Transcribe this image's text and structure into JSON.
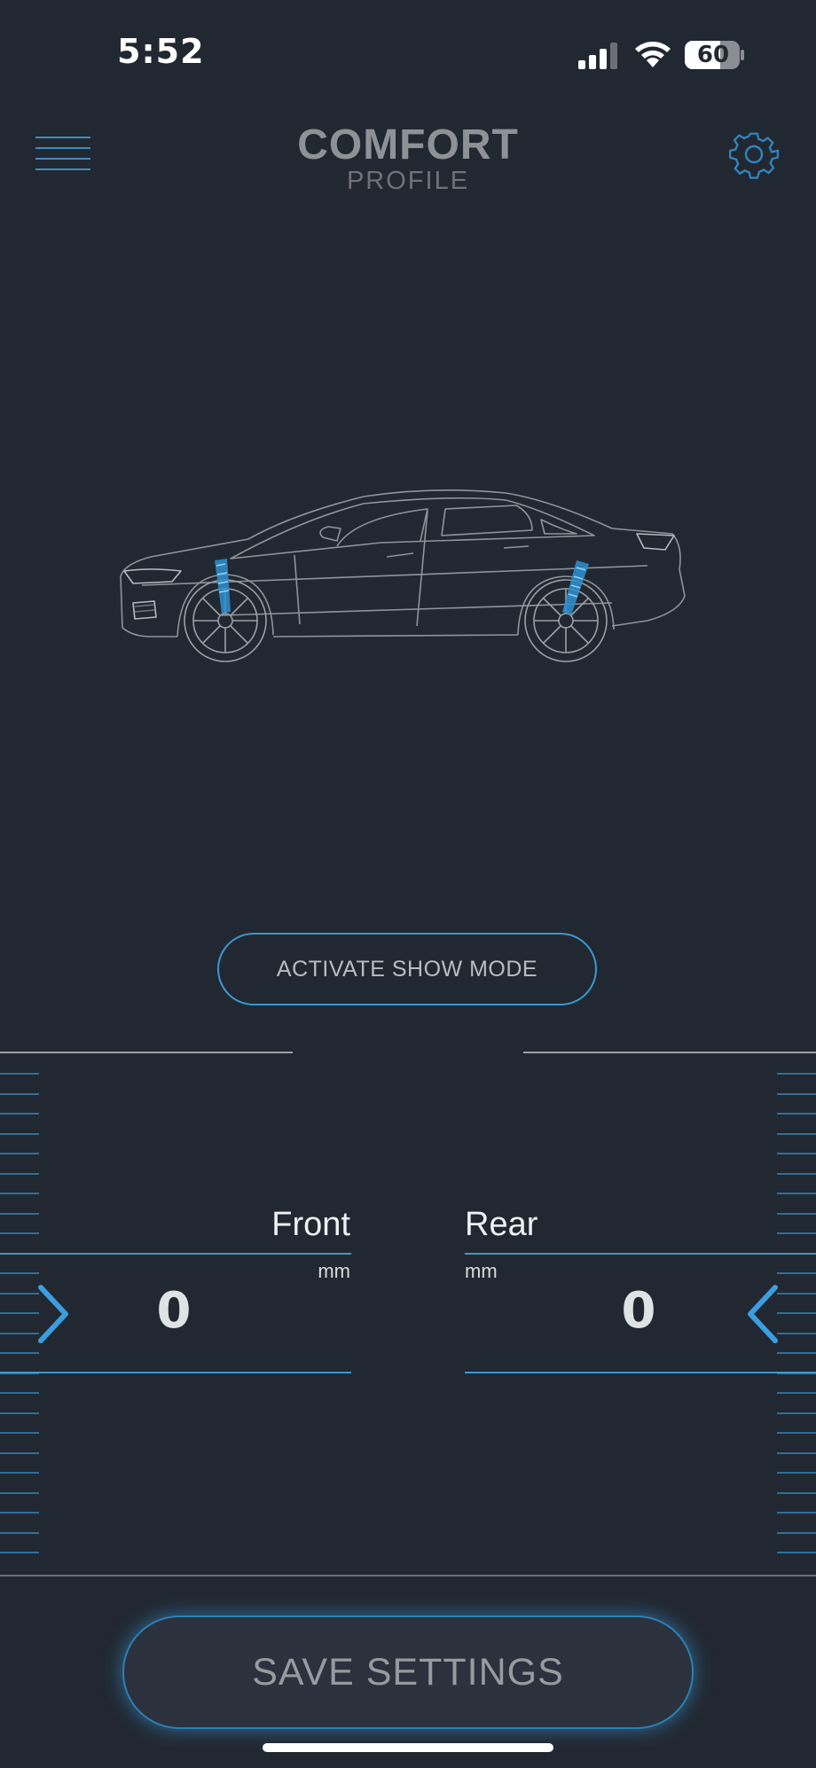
{
  "status_bar": {
    "time": "5:52",
    "battery_level": "60"
  },
  "header": {
    "title": "COMFORT",
    "subtitle": "PROFILE",
    "menu_icon": "hamburger-menu-icon",
    "settings_icon": "gear-icon"
  },
  "vehicle": {
    "image": "sedan-side-view-wireframe",
    "highlight_color": "#3aa4e0"
  },
  "show_mode": {
    "label": "ACTIVATE SHOW MODE"
  },
  "front": {
    "label": "Front",
    "unit": "mm",
    "value": "0",
    "control_icon": "chevron-right-icon"
  },
  "rear": {
    "label": "Rear",
    "unit": "mm",
    "value": "0",
    "control_icon": "chevron-left-icon"
  },
  "save": {
    "label": "SAVE SETTINGS"
  },
  "colors": {
    "background": "#222831",
    "accent": "#3a98d0",
    "title_text": "#8e9297"
  }
}
